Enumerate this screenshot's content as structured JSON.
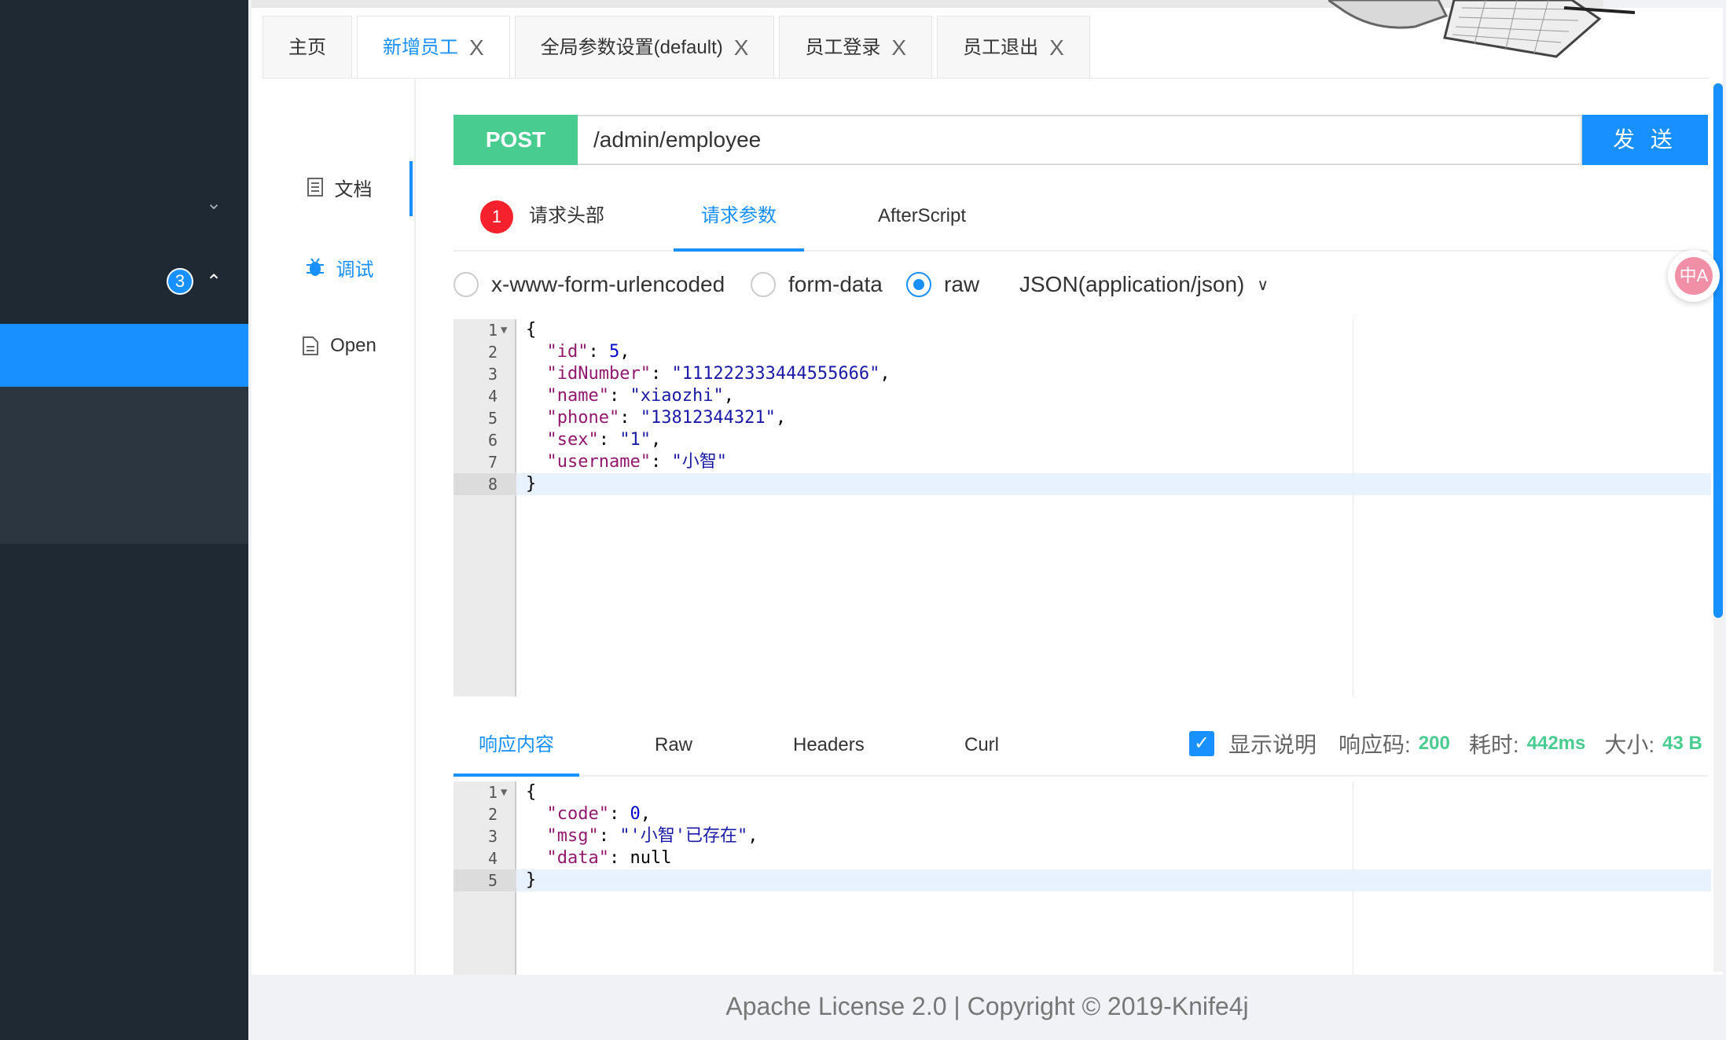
{
  "sidebar": {
    "badge_count": "3",
    "collapse_icon": "chevron-down-icon",
    "expand_icon": "chevron-up-icon"
  },
  "tabs": [
    {
      "label": "主页",
      "closable": false,
      "active": false
    },
    {
      "label": "新增员工",
      "closable": true,
      "active": true
    },
    {
      "label": "全局参数设置(default)",
      "closable": true,
      "active": false
    },
    {
      "label": "员工登录",
      "closable": true,
      "active": false
    },
    {
      "label": "员工退出",
      "closable": true,
      "active": false
    }
  ],
  "tab_close_glyph": "X",
  "doc_menu": [
    {
      "label": "文档",
      "icon": "document-icon"
    },
    {
      "label": "调试",
      "icon": "bug-icon",
      "active": true
    },
    {
      "label": "Open",
      "icon": "file-icon"
    }
  ],
  "request": {
    "method": "POST",
    "url": "/admin/employee",
    "send_label": "发 送"
  },
  "request_tabs": {
    "badge": "1",
    "headers": "请求头部",
    "params": "请求参数",
    "after": "AfterScript"
  },
  "body_types": {
    "urlencoded": "x-www-form-urlencoded",
    "formdata": "form-data",
    "raw": "raw",
    "content_type": "JSON(application/json)",
    "selected": "raw"
  },
  "request_body_lines": [
    "1",
    "2",
    "3",
    "4",
    "5",
    "6",
    "7",
    "8"
  ],
  "request_body": {
    "id": "5",
    "idNumber": "\"111222333444555666\"",
    "name": "\"xiaozhi\"",
    "phone": "\"13812344321\"",
    "sex": "\"1\"",
    "username": "\"小智\""
  },
  "response_tabs": {
    "content": "响应内容",
    "raw": "Raw",
    "headers": "Headers",
    "curl": "Curl"
  },
  "response_meta": {
    "show_desc": "显示说明",
    "code_label": "响应码:",
    "code": "200",
    "time_label": "耗时:",
    "time": "442ms",
    "size_label": "大小:",
    "size": "43 B"
  },
  "response_body": {
    "code": "0",
    "msg": "\"'小智'已存在\"",
    "data": "null"
  },
  "footer": "Apache License 2.0 | Copyright © 2019-Knife4j",
  "float_button": "中A",
  "colors": {
    "primary": "#1890ff",
    "post": "#49cc90",
    "sidebar": "#1f2933"
  }
}
